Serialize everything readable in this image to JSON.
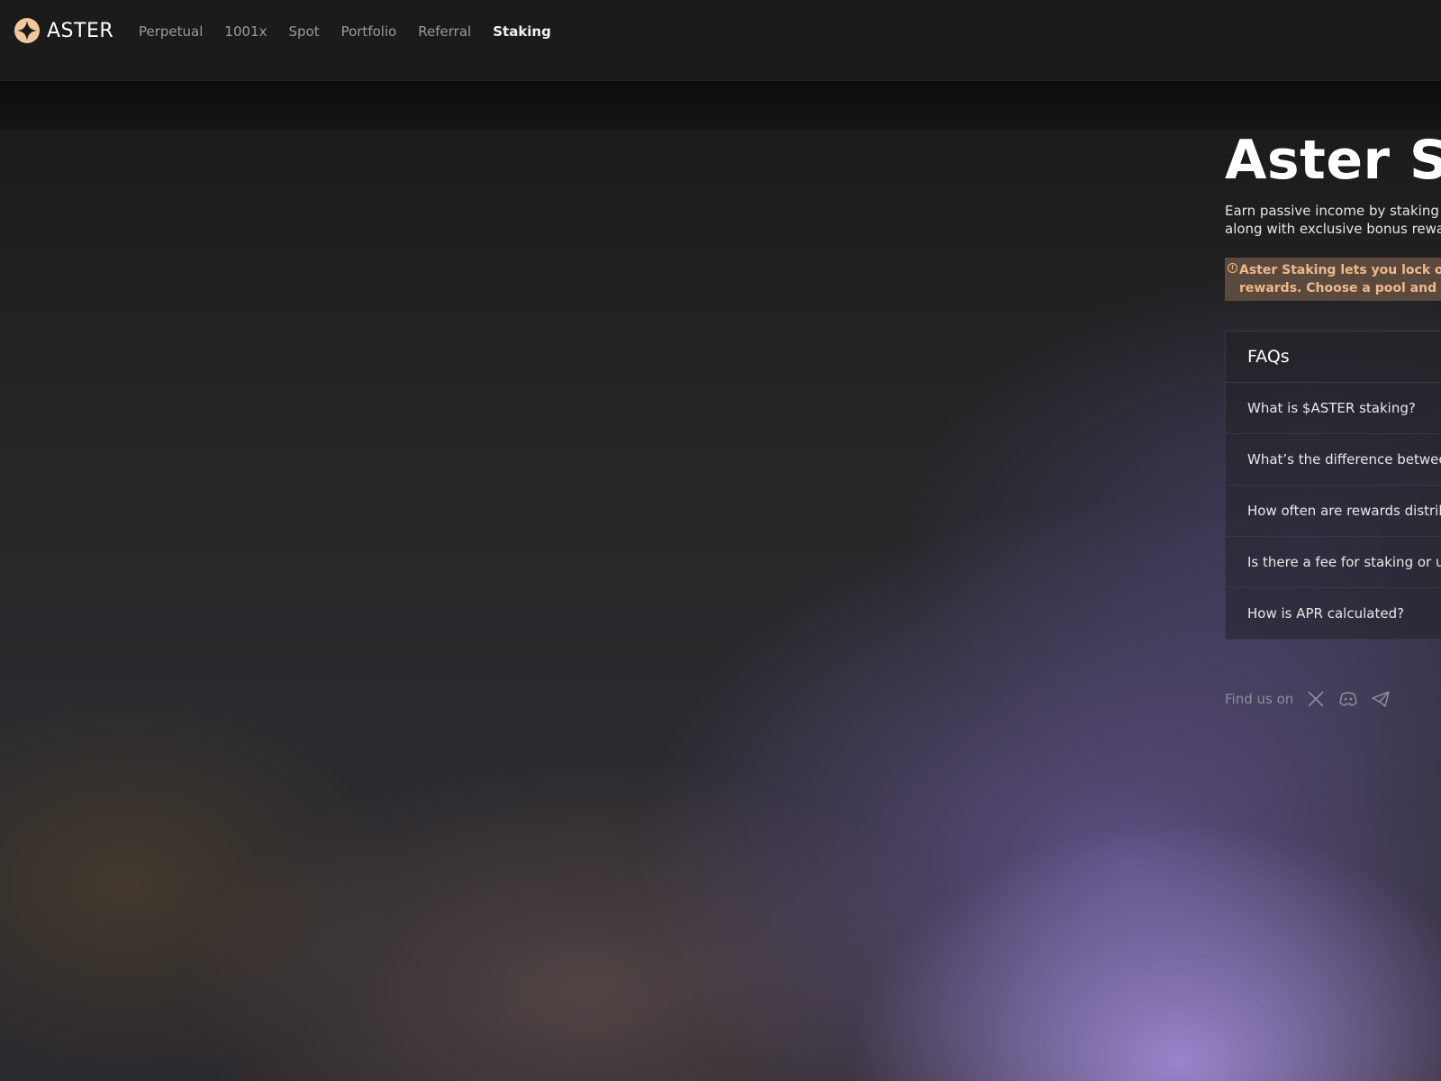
{
  "header": {
    "logo_text": "ASTER",
    "nav": [
      {
        "label": "Perpetual",
        "active": false
      },
      {
        "label": "1001x",
        "active": false
      },
      {
        "label": "Spot",
        "active": false
      },
      {
        "label": "Portfolio",
        "active": false
      },
      {
        "label": "Referral",
        "active": false
      },
      {
        "label": "Staking",
        "active": true
      }
    ]
  },
  "main": {
    "title": "Aster Sta",
    "subtitle_line1": "Earn passive income by staking yo",
    "subtitle_line2": "along with exclusive bonus reward",
    "notice_line1": "Aster Staking lets you lock or flexi",
    "notice_line2": "rewards. Choose a pool and grow",
    "notice_icon": "info-icon",
    "notice_color": "#f0b888"
  },
  "faq": {
    "heading": "FAQs",
    "items": [
      "What is $ASTER staking?",
      "What’s the difference between",
      "How often are rewards distribu",
      "Is there a fee for staking or uns",
      "How is APR calculated?"
    ]
  },
  "social": {
    "label": "Find us on",
    "icons": [
      "x-icon",
      "discord-icon",
      "telegram-icon"
    ]
  },
  "colors": {
    "accent": "#f0b888",
    "header_bg": "#1b1b1b"
  }
}
